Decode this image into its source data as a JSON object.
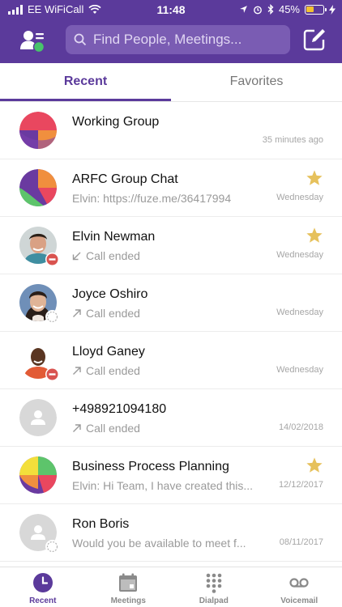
{
  "status_bar": {
    "carrier": "EE WiFiCall",
    "time": "11:48",
    "battery": "45%",
    "battery_level": 0.45,
    "icons": [
      "signal-icon",
      "wifi-icon",
      "location-icon",
      "alarm-icon",
      "bluetooth-icon",
      "battery-icon",
      "charging-icon"
    ]
  },
  "header": {
    "search_placeholder": "Find People, Meetings...",
    "icons": [
      "contacts-icon",
      "search-icon",
      "compose-icon"
    ]
  },
  "tabs": [
    {
      "label": "Recent",
      "active": true
    },
    {
      "label": "Favorites",
      "active": false
    }
  ],
  "conversations": [
    {
      "name": "Working Group",
      "subtitle": "",
      "time": "35 minutes ago",
      "favorite": false,
      "avatar": "group-avatar-red",
      "call_icon": "",
      "presence": ""
    },
    {
      "name": "ARFC Group Chat",
      "subtitle": "Elvin: https://fuze.me/36417994",
      "time": "Wednesday",
      "favorite": true,
      "avatar": "group-avatar-purple",
      "call_icon": "",
      "presence": ""
    },
    {
      "name": "Elvin Newman",
      "subtitle": "Call ended",
      "time": "Wednesday",
      "favorite": true,
      "avatar": "person-photo",
      "call_icon": "incoming-call-icon",
      "presence": "busy"
    },
    {
      "name": "Joyce Oshiro",
      "subtitle": "Call ended",
      "time": "Wednesday",
      "favorite": false,
      "avatar": "person-photo",
      "call_icon": "outgoing-call-icon",
      "presence": "offline"
    },
    {
      "name": "Lloyd Ganey",
      "subtitle": "Call ended",
      "time": "Wednesday",
      "favorite": false,
      "avatar": "person-photo",
      "call_icon": "outgoing-call-icon",
      "presence": "busy"
    },
    {
      "name": "+498921094180",
      "subtitle": "Call ended",
      "time": "14/02/2018",
      "favorite": false,
      "avatar": "default-avatar",
      "call_icon": "outgoing-call-icon",
      "presence": ""
    },
    {
      "name": "Business Process Planning",
      "subtitle": "Elvin: Hi Team, I have created this...",
      "time": "12/12/2017",
      "favorite": true,
      "avatar": "group-avatar-yellow",
      "call_icon": "",
      "presence": ""
    },
    {
      "name": "Ron Boris",
      "subtitle": "Would you be available to meet f...",
      "time": "08/11/2017",
      "favorite": false,
      "avatar": "default-avatar",
      "call_icon": "",
      "presence": "offline"
    }
  ],
  "bottom_nav": [
    {
      "label": "Recent",
      "icon": "clock-icon",
      "active": true
    },
    {
      "label": "Meetings",
      "icon": "calendar-icon",
      "active": false
    },
    {
      "label": "Dialpad",
      "icon": "dialpad-icon",
      "active": false
    },
    {
      "label": "Voicemail",
      "icon": "voicemail-icon",
      "active": false
    }
  ],
  "colors": {
    "brand_purple": "#5b3a9b",
    "search_bg": "#7a5cb3",
    "star_gold": "#e6c15c",
    "busy_red": "#d9534f"
  }
}
